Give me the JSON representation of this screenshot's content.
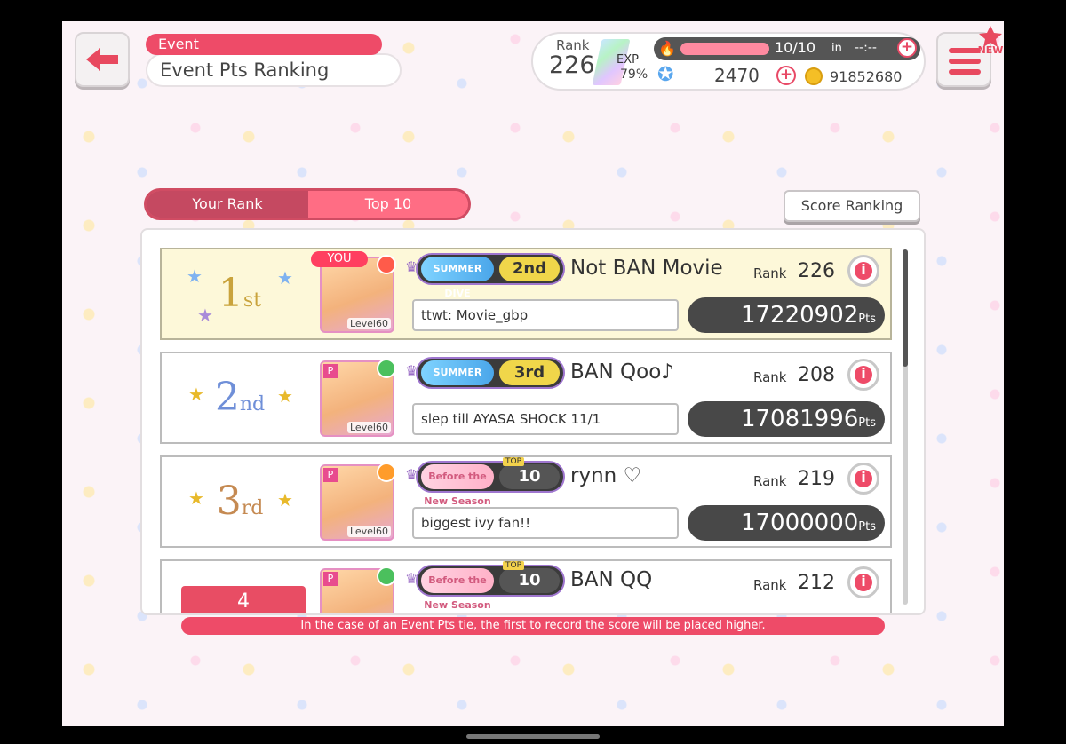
{
  "header": {
    "category": "Event",
    "title": "Event Pts Ranking"
  },
  "status": {
    "rank_label": "Rank",
    "rank_value": "226",
    "exp_label": "EXP",
    "exp_percent": "79%",
    "stamina": "10/10",
    "stamina_in": "in",
    "stamina_timer": "--:--",
    "stars": "2470",
    "coins": "91852680"
  },
  "menu": {
    "new_badge": "NEW"
  },
  "tabs": [
    {
      "label": "Your Rank",
      "active": true
    },
    {
      "label": "Top 10",
      "active": false
    }
  ],
  "score_ranking_label": "Score Ranking",
  "rows": [
    {
      "place_num": "1",
      "place_sfx": "st",
      "is_you": true,
      "you_label": "YOU",
      "level": "Level60",
      "badge_event": "SUMMER DIVE",
      "badge_rank": "2nd",
      "name": "Not BAN Movie",
      "rank_word": "Rank",
      "rank": "226",
      "comment": "ttwt: Movie_gbp",
      "points": "17220902",
      "pts_unit": "Pts"
    },
    {
      "place_num": "2",
      "place_sfx": "nd",
      "is_you": false,
      "level": "Level60",
      "badge_event": "SUMMER DIVE",
      "badge_rank": "3rd",
      "name": "BAN Qoo♪",
      "rank_word": "Rank",
      "rank": "208",
      "comment": "slep till AYASA SHOCK 11/1",
      "points": "17081996",
      "pts_unit": "Pts"
    },
    {
      "place_num": "3",
      "place_sfx": "rd",
      "is_you": false,
      "level": "Level60",
      "badge_event": "Before the New Season",
      "badge_top": "TOP",
      "badge_rank": "10",
      "name": "rynn ♡",
      "rank_word": "Rank",
      "rank": "219",
      "comment": "biggest ivy fan!!",
      "points": "17000000",
      "pts_unit": "Pts"
    },
    {
      "place_num": "4",
      "badge_event": "Before the New Season",
      "badge_top": "TOP",
      "badge_rank": "10",
      "name": "BAN QQ",
      "rank_word": "Rank",
      "rank": "212"
    }
  ],
  "footer_note": "In the case of an Event Pts tie, the first to record the score will be placed higher.",
  "colors": {
    "accent": "#ee4b68",
    "tab_active": "#c54961",
    "you_row": "#fdf8d9"
  }
}
